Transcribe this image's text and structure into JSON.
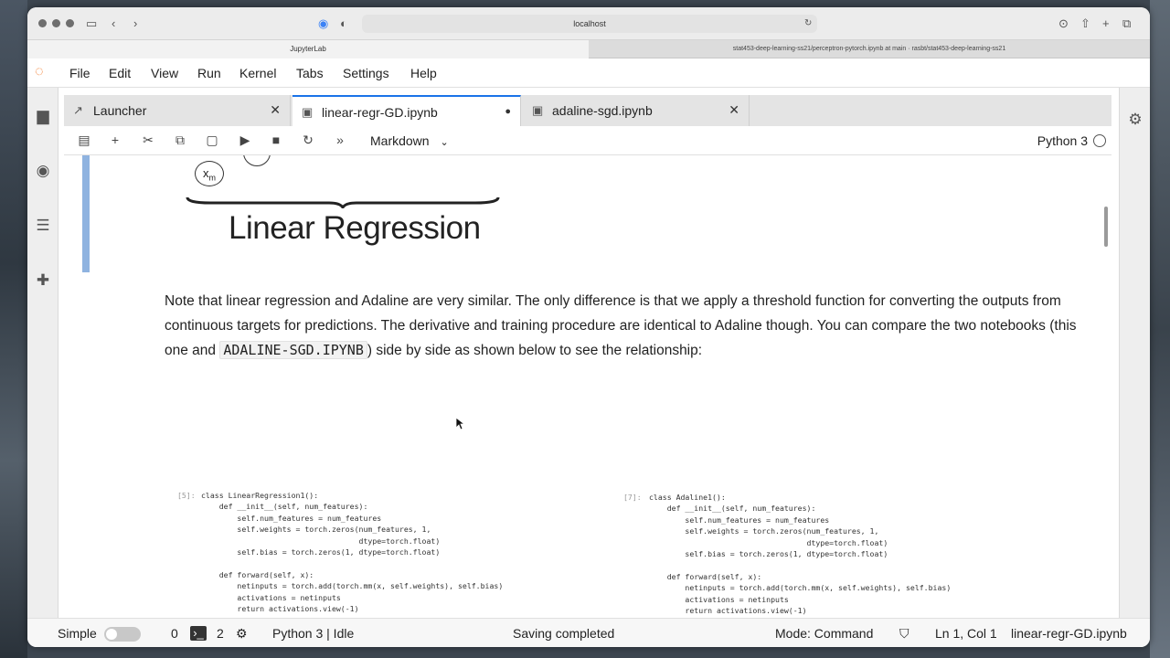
{
  "browser": {
    "url": "localhost",
    "tabs": [
      {
        "label": "JupyterLab"
      },
      {
        "label": "stat453-deep-learning-ss21/perceptron-pytorch.ipynb at main · rasbt/stat453-deep-learning-ss21"
      }
    ]
  },
  "menu": [
    "File",
    "Edit",
    "View",
    "Run",
    "Kernel",
    "Tabs",
    "Settings",
    "Help"
  ],
  "doc_tabs": [
    {
      "label": "Launcher",
      "close": "✕"
    },
    {
      "label": "linear-regr-GD.ipynb",
      "close": "●"
    },
    {
      "label": "adaline-sgd.ipynb",
      "close": "✕"
    }
  ],
  "toolbar": {
    "cell_type": "Markdown",
    "kernel": "Python 3"
  },
  "notebook": {
    "diagram_node": "x",
    "diagram_node_sub": "m",
    "title": "Linear Regression",
    "paragraph_before": "Note that linear regression and Adaline are very similar. The only difference is that we apply a threshold function for converting the outputs from continuous targets for predictions. The derivative and training procedure are identical to Adaline though. You can compare the two notebooks (this one and ",
    "paragraph_code": "adaline-sgd.ipynb",
    "paragraph_after": ") side by side as shown below to see the relationship:",
    "code_left_prompt": "[5]:",
    "code_left": "class LinearRegression1():\n    def __init__(self, num_features):\n        self.num_features = num_features\n        self.weights = torch.zeros(num_features, 1,\n                                   dtype=torch.float)\n        self.bias = torch.zeros(1, dtype=torch.float)\n\n    def forward(self, x):\n        netinputs = torch.add(torch.mm(x, self.weights), self.bias)\n        activations = netinputs\n        return activations.view(-1)",
    "code_right_prompt": "[7]:",
    "code_right": "class Adaline1():\n    def __init__(self, num_features):\n        self.num_features = num_features\n        self.weights = torch.zeros(num_features, 1,\n                                   dtype=torch.float)\n        self.bias = torch.zeros(1, dtype=torch.float)\n\n    def forward(self, x):\n        netinputs = torch.add(torch.mm(x, self.weights), self.bias)\n        activations = netinputs\n        return activations.view(-1)"
  },
  "status": {
    "mode_label": "Simple",
    "terminals": "0",
    "kernels": "2",
    "kernel_state": "Python 3 | Idle",
    "message": "Saving completed",
    "mode": "Mode: Command",
    "position": "Ln 1, Col 1",
    "filename": "linear-regr-GD.ipynb"
  },
  "colors": {
    "accent": "#1a73e8",
    "jupyter_orange": "#f37726",
    "cell_bar": "#8fb3e0"
  }
}
